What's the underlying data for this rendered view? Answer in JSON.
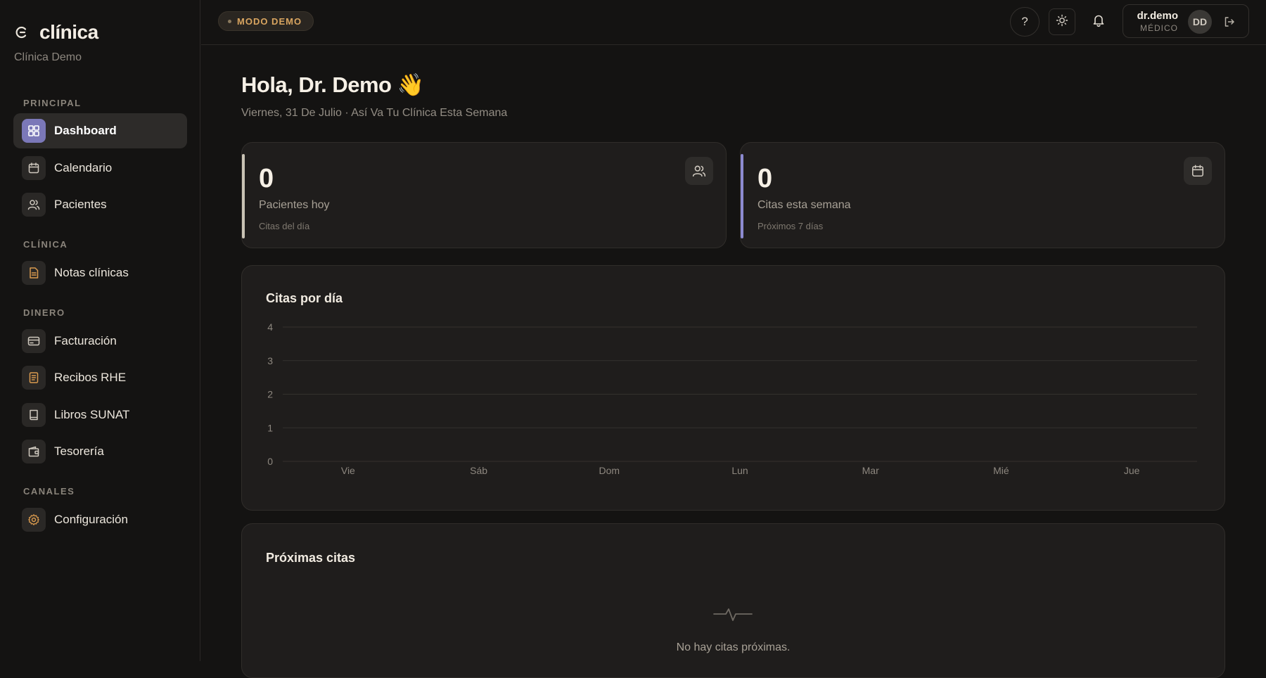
{
  "brand": {
    "title": "clínica",
    "subtitle": "Clínica Demo"
  },
  "sidebar": {
    "sections": [
      {
        "label": "PRINCIPAL",
        "items": [
          {
            "label": "Dashboard",
            "icon": "dashboard-icon",
            "active": true
          },
          {
            "label": "Calendario",
            "icon": "calendar-icon"
          },
          {
            "label": "Pacientes",
            "icon": "users-icon"
          }
        ]
      },
      {
        "label": "CLÍNICA",
        "items": [
          {
            "label": "Notas clínicas",
            "icon": "document-icon"
          }
        ]
      },
      {
        "label": "DINERO",
        "items": [
          {
            "label": "Facturación",
            "icon": "credit-card-icon"
          },
          {
            "label": "Recibos RHE",
            "icon": "receipt-icon"
          },
          {
            "label": "Libros SUNAT",
            "icon": "book-icon"
          },
          {
            "label": "Tesorería",
            "icon": "wallet-icon"
          }
        ]
      },
      {
        "label": "CANALES",
        "items": [
          {
            "label": "Configuración",
            "icon": "gear-icon"
          }
        ]
      }
    ]
  },
  "topbar": {
    "demo_badge": "MODO DEMO",
    "help_label": "?",
    "user": {
      "name": "dr.demo",
      "role": "MÉDICO",
      "initials": "DD"
    }
  },
  "main": {
    "greeting": "Hola, Dr. Demo 👋",
    "subline": "Viernes, 31 De Julio · Así Va Tu Clínica Esta Semana",
    "stats": [
      {
        "value": "0",
        "label": "Pacientes hoy",
        "sub": "Citas del día",
        "accent": "#c9c3b5",
        "icon": "users-icon"
      },
      {
        "value": "0",
        "label": "Citas esta semana",
        "sub": "Próximos 7 días",
        "accent": "#8c8ad0",
        "icon": "calendar-icon"
      }
    ],
    "upcoming": {
      "title": "Próximas citas",
      "empty_text": "No hay citas próximas."
    }
  },
  "chart_data": {
    "type": "bar",
    "title": "Citas por día",
    "categories": [
      "Vie",
      "Sáb",
      "Dom",
      "Lun",
      "Mar",
      "Mié",
      "Jue"
    ],
    "values": [
      0,
      0,
      0,
      0,
      0,
      0,
      0
    ],
    "y_ticks": [
      "0",
      "1",
      "2",
      "3",
      "4"
    ],
    "ylim": [
      0,
      4
    ],
    "grid": true
  }
}
